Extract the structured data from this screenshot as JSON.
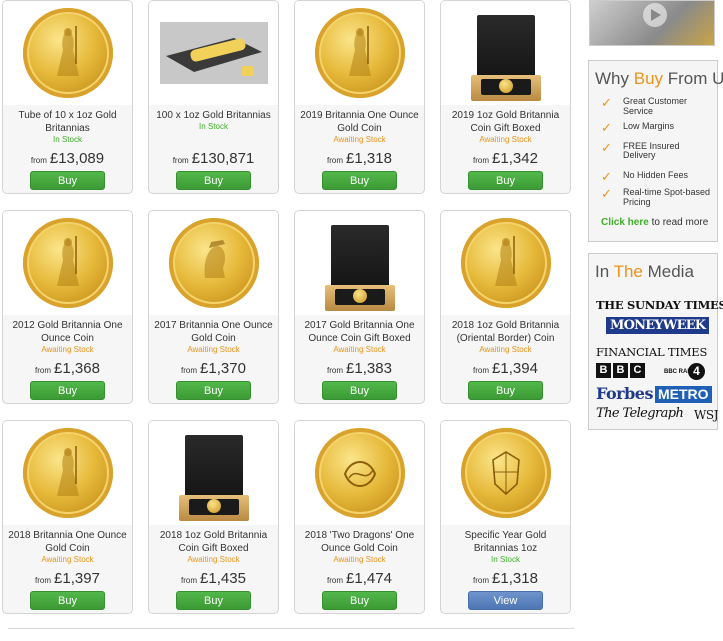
{
  "products": [
    {
      "title": "Tube of 10 x 1oz Gold Britannias",
      "stock": "In Stock",
      "stock_type": "in",
      "from": "from",
      "price": "£13,089",
      "button": "Buy",
      "image": "britannia-coin"
    },
    {
      "title": "100 x 1oz Gold Britannias",
      "stock": "In Stock",
      "stock_type": "in",
      "from": "from",
      "price": "£130,871",
      "button": "Buy",
      "image": "tube-box"
    },
    {
      "title": "2019 Britannia One Ounce Gold Coin",
      "stock": "Awaiting Stock",
      "stock_type": "await",
      "from": "from",
      "price": "£1,318",
      "button": "Buy",
      "image": "britannia-coin"
    },
    {
      "title": "2019 1oz Gold Britannia Coin Gift Boxed",
      "stock": "Awaiting Stock",
      "stock_type": "await",
      "from": "from",
      "price": "£1,342",
      "button": "Buy",
      "image": "gift-box"
    },
    {
      "title": "2012 Gold Britannia One Ounce Coin",
      "stock": "Awaiting Stock",
      "stock_type": "await",
      "from": "from",
      "price": "£1,368",
      "button": "Buy",
      "image": "britannia-coin"
    },
    {
      "title": "2017 Britannia One Ounce Gold Coin",
      "stock": "Awaiting Stock",
      "stock_type": "await",
      "from": "from",
      "price": "£1,370",
      "button": "Buy",
      "image": "queen-coin"
    },
    {
      "title": "2017 Gold Britannia One Ounce Coin Gift Boxed",
      "stock": "Awaiting Stock",
      "stock_type": "await",
      "from": "from",
      "price": "£1,383",
      "button": "Buy",
      "image": "gift-box"
    },
    {
      "title": "2018 1oz Gold Britannia (Oriental Border) Coin",
      "stock": "Awaiting Stock",
      "stock_type": "await",
      "from": "from",
      "price": "£1,394",
      "button": "Buy",
      "image": "britannia-coin"
    },
    {
      "title": "2018 Britannia One Ounce Gold Coin",
      "stock": "Awaiting Stock",
      "stock_type": "await",
      "from": "from",
      "price": "£1,397",
      "button": "Buy",
      "image": "britannia-coin"
    },
    {
      "title": "2018 1oz Gold Britannia Coin Gift Boxed",
      "stock": "Awaiting Stock",
      "stock_type": "await",
      "from": "from",
      "price": "£1,435",
      "button": "Buy",
      "image": "gift-box"
    },
    {
      "title": "2018 'Two Dragons' One Ounce Gold Coin",
      "stock": "Awaiting Stock",
      "stock_type": "await",
      "from": "from",
      "price": "£1,474",
      "button": "Buy",
      "image": "dragon-coin"
    },
    {
      "title": "Specific Year Gold Britannias 1oz",
      "stock": "In Stock",
      "stock_type": "in",
      "from": "from",
      "price": "£1,318",
      "button": "View",
      "image": "britannia-shield-coin"
    }
  ],
  "why": {
    "title_prefix": "Why ",
    "title_accent": "Buy",
    "title_suffix": " From Us?",
    "items": [
      "Great Customer Service",
      "Low Margins",
      "FREE Insured Delivery",
      "No Hidden Fees",
      "Real-time Spot-based Pricing"
    ],
    "more_link": "Click here",
    "more_suffix": " to read more"
  },
  "media": {
    "title_prefix": "In ",
    "title_accent": "The",
    "title_suffix": " Media",
    "logos": [
      "THE SUNDAY TIMES",
      "MONEYWEEK",
      "FINANCIAL TIMES",
      "BBC",
      "BBC RADIO 4",
      "Forbes",
      "METRO",
      "The Telegraph",
      "WSJ"
    ]
  },
  "colors": {
    "buy_green": "#3fae2a",
    "awaiting_orange": "#e8941a",
    "view_blue": "#5b81bd"
  }
}
